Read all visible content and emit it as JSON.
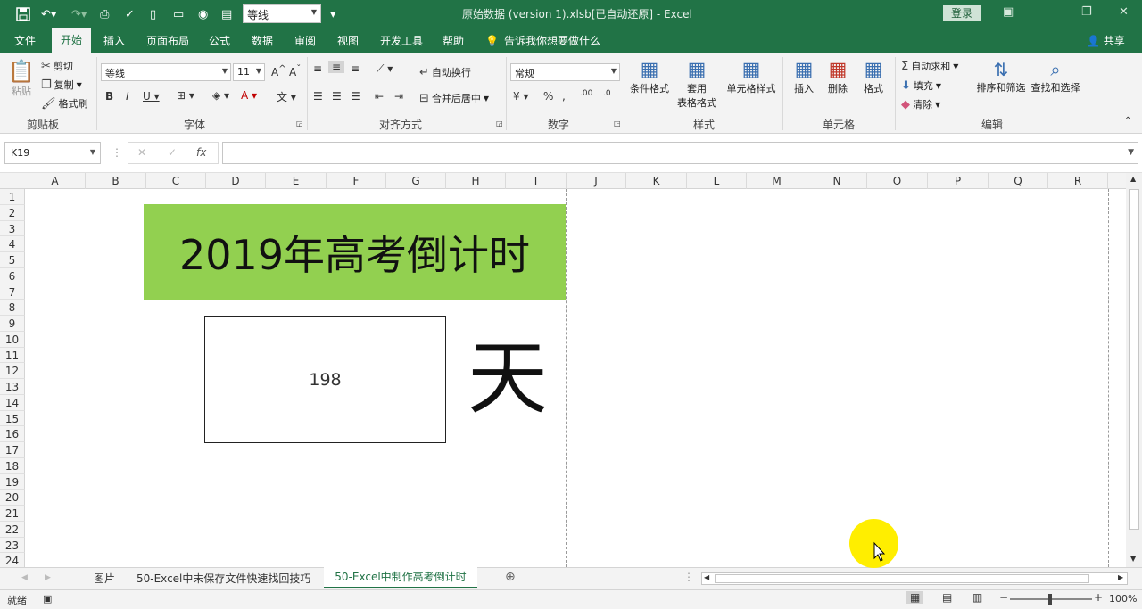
{
  "titlebar": {
    "font_quick": "等线",
    "doc_title": "原始数据 (version 1).xlsb[已自动还原] - Excel",
    "login": "登录"
  },
  "ribbon_tabs": [
    "文件",
    "开始",
    "插入",
    "页面布局",
    "公式",
    "数据",
    "审阅",
    "视图",
    "开发工具",
    "帮助"
  ],
  "tell_me": "告诉我你想要做什么",
  "share": "共享",
  "clipboard": {
    "paste": "粘贴",
    "cut": "剪切",
    "copy": "复制",
    "format_painter": "格式刷",
    "group": "剪贴板"
  },
  "font": {
    "name": "等线",
    "size": "11",
    "group": "字体"
  },
  "alignment": {
    "wrap": "自动换行",
    "merge": "合并后居中",
    "group": "对齐方式"
  },
  "number": {
    "format": "常规",
    "group": "数字"
  },
  "styles": {
    "conditional": "条件格式",
    "table_a": "套用",
    "table_b": "表格格式",
    "cell_styles": "单元格样式",
    "group": "样式"
  },
  "cells": {
    "insert": "插入",
    "delete": "删除",
    "format": "格式",
    "group": "单元格"
  },
  "editing": {
    "autosum": "自动求和",
    "fill": "填充",
    "clear": "清除",
    "sort": "排序和筛选",
    "find": "查找和选择",
    "group": "编辑"
  },
  "formula_bar": {
    "name_box": "K19",
    "fx": "fx",
    "value": ""
  },
  "columns": [
    "A",
    "B",
    "C",
    "D",
    "E",
    "F",
    "G",
    "H",
    "I",
    "J",
    "K",
    "L",
    "M",
    "N",
    "O",
    "P",
    "Q",
    "R"
  ],
  "rows": [
    "1",
    "2",
    "3",
    "4",
    "5",
    "6",
    "7",
    "8",
    "9",
    "10",
    "11",
    "12",
    "13",
    "14",
    "15",
    "16",
    "17",
    "18",
    "19",
    "20",
    "21",
    "22",
    "23",
    "24"
  ],
  "sheet": {
    "banner_text": "2019年高考倒计时",
    "countdown_value": "198",
    "day_char": "天",
    "banner_color": "#92d050"
  },
  "sheet_tabs": {
    "tab1": "图片",
    "tab2": "50-Excel中未保存文件快速找回技巧",
    "active": "50-Excel中制作高考倒计时"
  },
  "status": {
    "ready": "就绪",
    "zoom": "100%"
  },
  "colors": {
    "accent": "#217346"
  }
}
